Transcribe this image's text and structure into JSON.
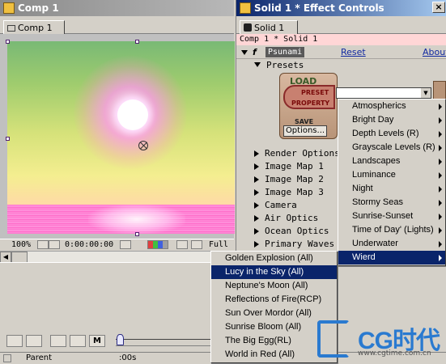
{
  "comp_window": {
    "title": "Comp 1",
    "tab": "Comp 1",
    "status": {
      "zoom": "100%",
      "timecode": "0:00:00:00",
      "resolution": "Full"
    }
  },
  "effect_controls": {
    "title": "Solid 1 * Effect Controls",
    "close_glyph": "×",
    "tab": "Solid 1",
    "breadcrumb": "Comp 1 * Solid 1",
    "effect": {
      "fx_glyph": "f",
      "name": "Psunami",
      "reset": "Reset",
      "about": "About"
    },
    "presets_label": "Presets",
    "preset_panel": {
      "load": "LOAD",
      "preset": "PRESET",
      "property": "PROPERTY",
      "save": "SAVE",
      "options": "Options..."
    },
    "groups": [
      "Render Options",
      "Image Map 1",
      "Image Map 2",
      "Image Map 3",
      "Camera",
      "Air Optics",
      "Ocean Optics",
      "Primary Waves"
    ]
  },
  "preset_menu": {
    "items": [
      {
        "label": "Atmospherics",
        "submenu": true,
        "selected": false
      },
      {
        "label": "Bright Day",
        "submenu": true,
        "selected": false
      },
      {
        "label": "Depth Levels (R)",
        "submenu": true,
        "selected": false
      },
      {
        "label": "Grayscale Levels (R)",
        "submenu": true,
        "selected": false
      },
      {
        "label": "Landscapes",
        "submenu": true,
        "selected": false
      },
      {
        "label": "Luminance",
        "submenu": true,
        "selected": false
      },
      {
        "label": "Night",
        "submenu": true,
        "selected": false
      },
      {
        "label": "Stormy Seas",
        "submenu": true,
        "selected": false
      },
      {
        "label": "Sunrise-Sunset",
        "submenu": true,
        "selected": false
      },
      {
        "label": "Time of Day' (Lights)",
        "submenu": true,
        "selected": false
      },
      {
        "label": "Underwater",
        "submenu": true,
        "selected": false
      },
      {
        "label": "Wierd",
        "submenu": true,
        "selected": true
      }
    ]
  },
  "wierd_submenu": {
    "items": [
      {
        "label": "Golden Explosion (All)",
        "selected": false
      },
      {
        "label": "Lucy in the Sky (All)",
        "selected": true
      },
      {
        "label": "Neptune's Moon (All)",
        "selected": false
      },
      {
        "label": "Reflections of Fire(RCP)",
        "selected": false
      },
      {
        "label": "Sun Over Mordor (All)",
        "selected": false
      },
      {
        "label": "Sunrise Bloom (All)",
        "selected": false
      },
      {
        "label": "The Big Egg(RL)",
        "selected": false
      },
      {
        "label": "World in Red (All)",
        "selected": false
      }
    ]
  },
  "timeline": {
    "column_header": "Parent",
    "ruler_label": ":00s",
    "buttons": [
      "",
      "",
      "",
      "",
      "M"
    ]
  },
  "watermark": {
    "logo_text": "CG时代",
    "url": "www.cgtime.com.cn"
  }
}
